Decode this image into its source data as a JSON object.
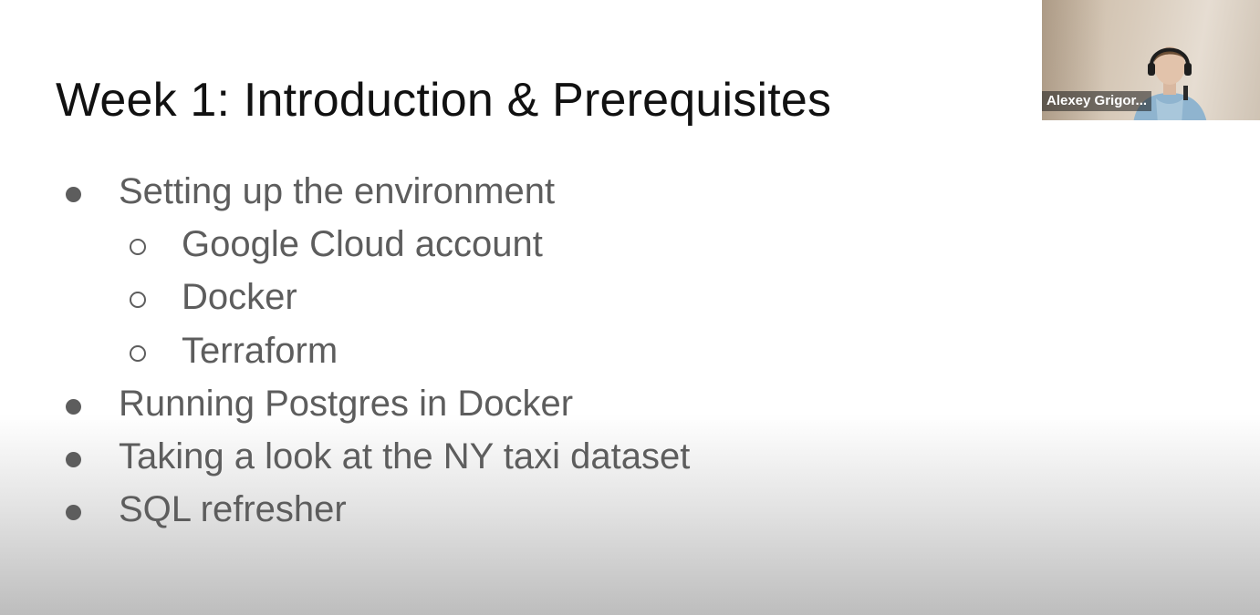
{
  "slide": {
    "title": "Week 1: Introduction & Prerequisites",
    "items": [
      {
        "level": 1,
        "text": "Setting up the environment"
      },
      {
        "level": 2,
        "text": "Google Cloud account"
      },
      {
        "level": 2,
        "text": "Docker"
      },
      {
        "level": 2,
        "text": "Terraform"
      },
      {
        "level": 1,
        "text": "Running Postgres in Docker"
      },
      {
        "level": 1,
        "text": "Taking a look at the NY taxi dataset"
      },
      {
        "level": 1,
        "text": "SQL refresher"
      }
    ]
  },
  "video": {
    "participant_name": "Alexey Grigor..."
  },
  "colors": {
    "title": "#111111",
    "bullet_text": "#5d5d5d",
    "background_top": "#ffffff",
    "background_bottom": "#bdbdbd"
  },
  "icons": {
    "level_1_marker": "filled-disc-bullet",
    "level_2_marker": "hollow-circle-bullet"
  }
}
